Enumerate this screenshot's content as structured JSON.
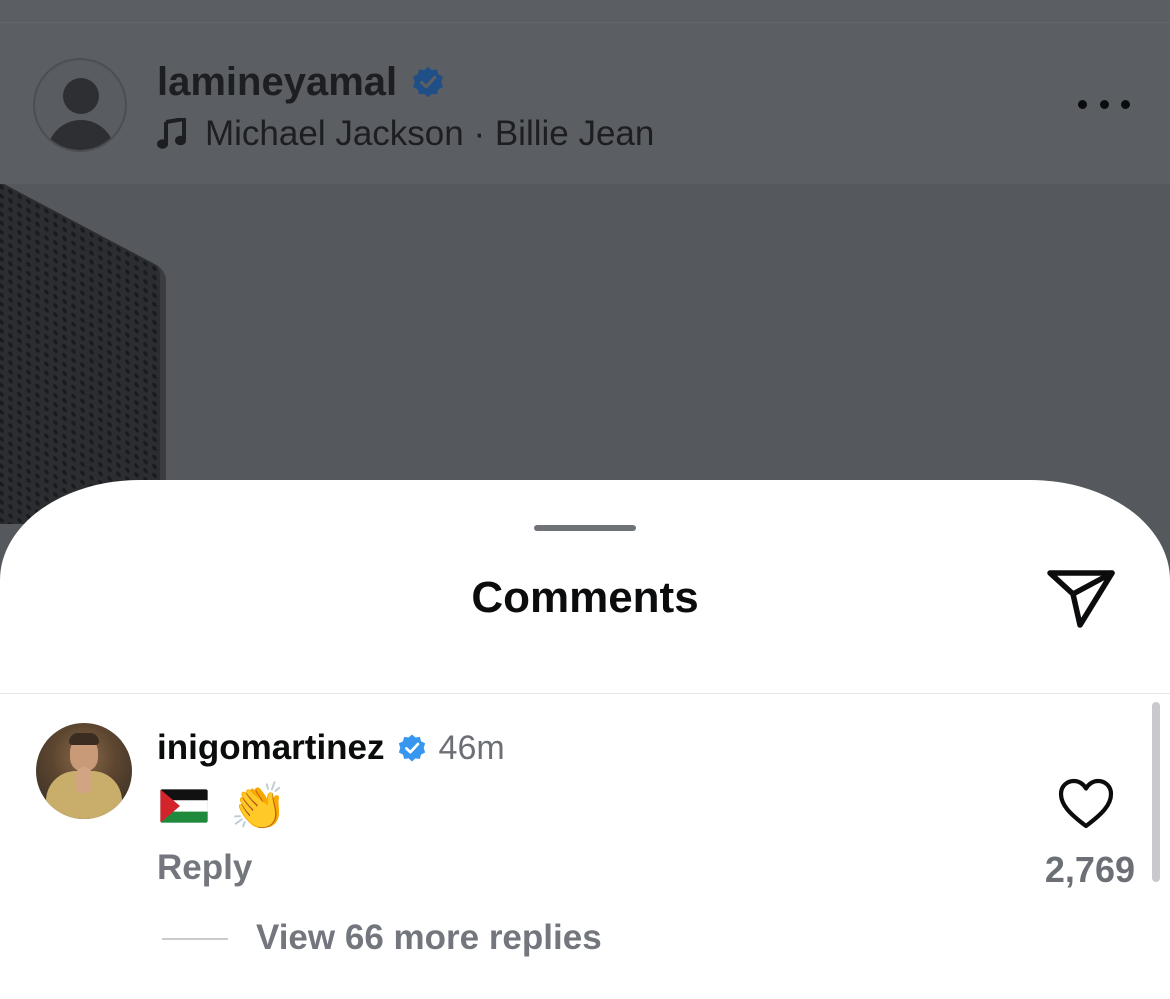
{
  "post": {
    "username": "lamineyamal",
    "verified": true,
    "music": "Michael Jackson · Billie Jean"
  },
  "sheet": {
    "title": "Comments"
  },
  "comment": {
    "username": "inigomartinez",
    "verified": true,
    "time": "46m",
    "flag_emoji": "🇵🇸",
    "clap_emoji": "👏",
    "reply_label": "Reply",
    "like_count": "2,769",
    "view_replies_label": "View 66 more replies"
  },
  "colors": {
    "verified_badge": "#3797f0",
    "overlay_dim": "#5b5e62",
    "secondary_text": "#73777d"
  },
  "icons": {
    "music": "music-note-icon",
    "more": "more-horizontal-icon",
    "share": "paper-plane-icon",
    "like": "heart-outline-icon",
    "verified": "verified-badge-icon"
  }
}
